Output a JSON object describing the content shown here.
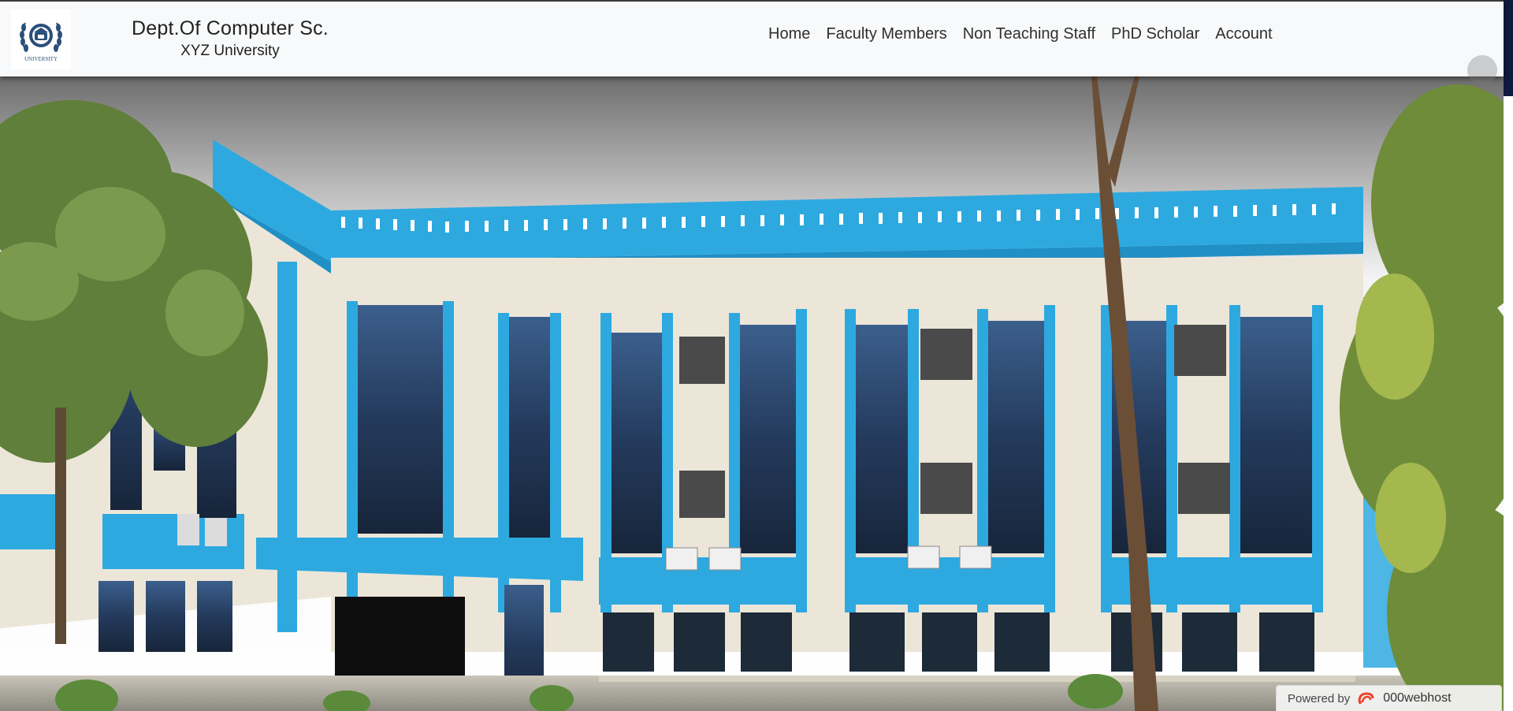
{
  "header": {
    "logo_text": "UNIVERSITY",
    "title": "Dept.Of Computer Sc.",
    "subtitle": "XYZ University"
  },
  "nav": {
    "items": [
      {
        "label": "Home"
      },
      {
        "label": "Faculty Members"
      },
      {
        "label": "Non Teaching Staff"
      },
      {
        "label": "PhD Scholar"
      },
      {
        "label": "Account"
      }
    ]
  },
  "hero": {
    "image_subject": "blue-and-cream department building with trees"
  },
  "footer_badge": {
    "prefix": "Powered by",
    "brand": "000webhost",
    "icon": "webhost-swirl-icon"
  },
  "colors": {
    "navbar_bg": "#f8f9fa",
    "building_blue": "#2ea9e0",
    "building_cream": "#ece6d8",
    "window_dark": "#20314a"
  }
}
